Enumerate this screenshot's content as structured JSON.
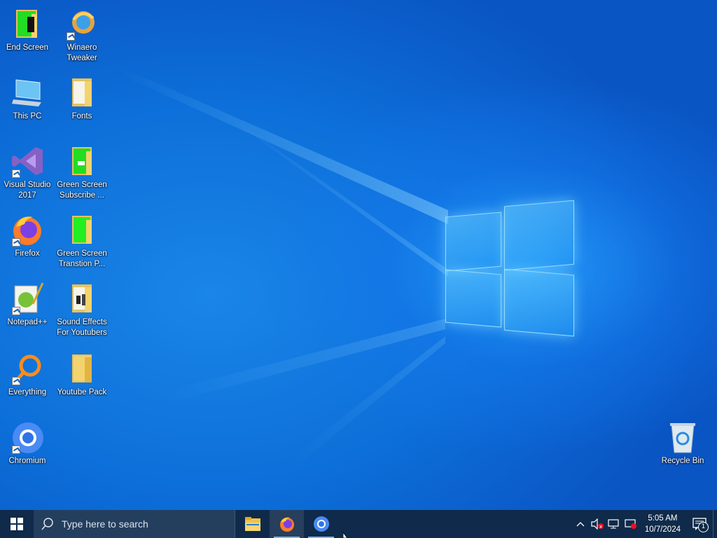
{
  "desktop": {
    "icons": [
      {
        "label": "End Screen",
        "icon": "folder-green-icon"
      },
      {
        "label": "Winaero Tweaker",
        "icon": "winaero-icon"
      },
      {
        "label": "This PC",
        "icon": "computer-icon"
      },
      {
        "label": "Fonts",
        "icon": "folder-icon"
      },
      {
        "label": "Visual Studio 2017",
        "icon": "visual-studio-icon"
      },
      {
        "label": "Green Screen Subscribe ...",
        "icon": "folder-green-icon"
      },
      {
        "label": "Firefox",
        "icon": "firefox-icon"
      },
      {
        "label": "Green Screen Transtion P...",
        "icon": "folder-green-icon"
      },
      {
        "label": "Notepad++",
        "icon": "notepadpp-icon"
      },
      {
        "label": "Sound Effects For Youtubers",
        "icon": "folder-audio-icon"
      },
      {
        "label": "Everything",
        "icon": "everything-search-icon"
      },
      {
        "label": "Youtube Pack",
        "icon": "folder-icon"
      },
      {
        "label": "Chromium",
        "icon": "chromium-icon"
      },
      {
        "label": "Recycle Bin",
        "icon": "recycle-bin-icon"
      }
    ]
  },
  "taskbar": {
    "search_placeholder": "Type here to search",
    "apps": [
      {
        "name": "File Explorer",
        "icon": "file-explorer-icon"
      },
      {
        "name": "Firefox",
        "icon": "firefox-icon"
      },
      {
        "name": "Chromium",
        "icon": "chromium-icon"
      }
    ],
    "clock": {
      "time": "5:05 AM",
      "date": "10/7/2024"
    },
    "notification_count": "1"
  },
  "colors": {
    "taskbar_bg": "#0f2a4a",
    "search_bg": "#243e5e",
    "wallpaper": "#0a5fd0"
  }
}
